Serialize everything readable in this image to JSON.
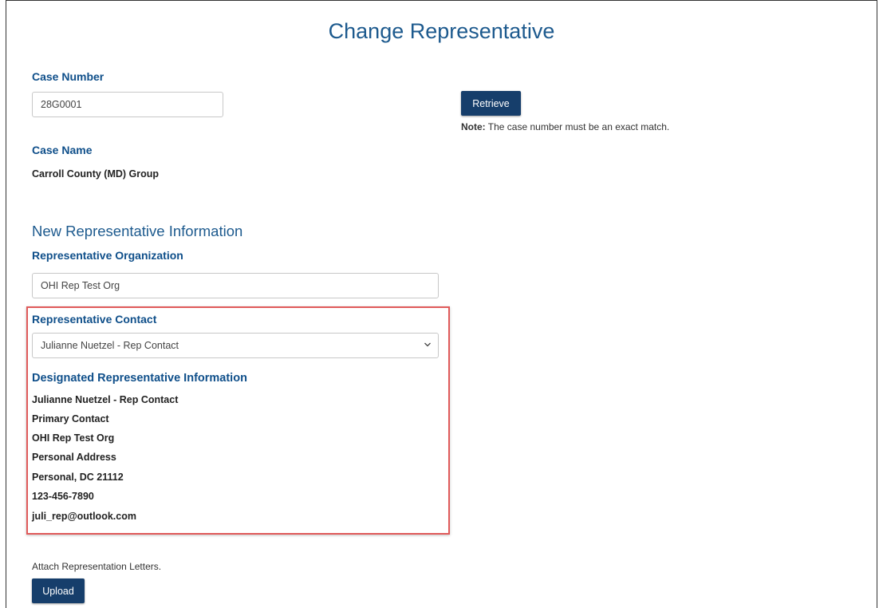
{
  "page": {
    "title": "Change Representative"
  },
  "case": {
    "number_label": "Case Number",
    "number_value": "28G0001",
    "retrieve_label": "Retrieve",
    "note_prefix": "Note:",
    "note_text": " The case number must be an exact match.",
    "name_label": "Case Name",
    "name_value": "Carroll County (MD) Group"
  },
  "new_rep": {
    "section_title": "New Representative Information",
    "org_label": "Representative Organization",
    "org_value": "OHI Rep Test Org",
    "contact_label": "Representative Contact",
    "contact_selected": "Julianne Nuetzel - Rep Contact",
    "designated_label": "Designated Representative Information",
    "designated_lines": [
      "Julianne Nuetzel - Rep Contact",
      "Primary Contact",
      "OHI Rep Test Org",
      "Personal Address",
      "Personal, DC 21112",
      "123-456-7890",
      "juli_rep@outlook.com"
    ]
  },
  "attach": {
    "text": "Attach Representation Letters.",
    "upload_label": "Upload"
  },
  "colors": {
    "heading_blue": "#1d5a8e",
    "button_navy": "#163e6b",
    "highlight_red": "#e05a5a"
  }
}
